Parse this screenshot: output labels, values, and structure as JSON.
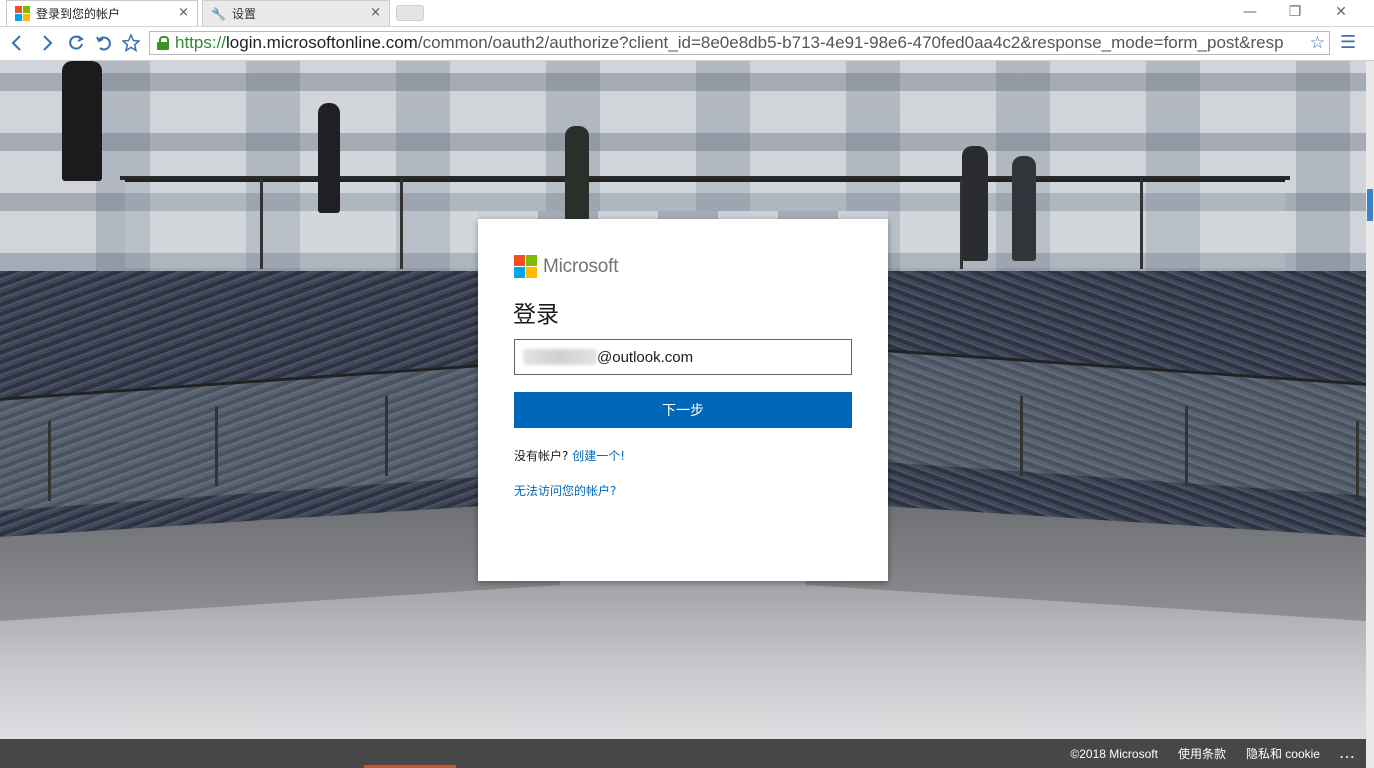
{
  "browser": {
    "tabs": [
      {
        "title": "登录到您的帐户",
        "close": "×"
      },
      {
        "title": "设置",
        "close": "×"
      }
    ],
    "url": {
      "scheme": "https://",
      "host": "login.microsoftonline.com",
      "path": "/common/oauth2/authorize?client_id=8e0e8db5-b713-4e91-98e6-470fed0aa4c2&response_mode=form_post&resp"
    },
    "window_controls": {
      "minimize": "—",
      "restore": "❐",
      "close": "✕"
    }
  },
  "colors": {
    "ms_red": "#f25022",
    "ms_green": "#7fba00",
    "ms_blue": "#00a4ef",
    "ms_yellow": "#ffb900",
    "primary_button": "#0067b8",
    "link": "#0067b8"
  },
  "signin": {
    "brand": "Microsoft",
    "title": "登录",
    "email_value": "@outlook.com",
    "next_button": "下一步",
    "no_account_text": "没有帐户?",
    "create_link": "创建一个!",
    "cant_access_link": "无法访问您的帐户?"
  },
  "footer": {
    "copyright": "©2018 Microsoft",
    "terms": "使用条款",
    "privacy": "隐私和 cookie",
    "more": "..."
  }
}
